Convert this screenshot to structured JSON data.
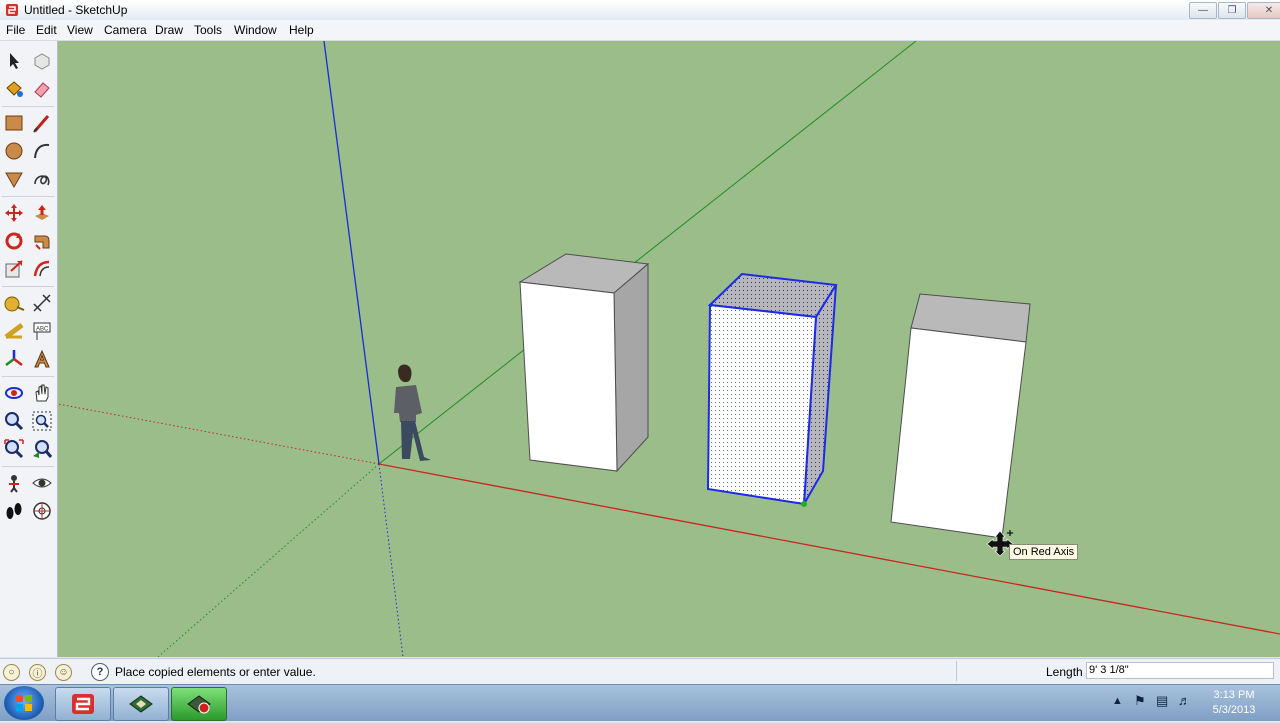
{
  "window": {
    "title": "Untitled - SketchUp"
  },
  "menu": [
    "File",
    "Edit",
    "View",
    "Camera",
    "Draw",
    "Tools",
    "Window",
    "Help"
  ],
  "toolbar": {
    "tools": [
      "select-icon",
      "make-component-icon",
      "paint-bucket-icon",
      "eraser-icon",
      "rectangle-icon",
      "line-icon",
      "circle-icon",
      "arc-icon",
      "polygon-icon",
      "freehand-icon",
      "move-icon",
      "push-pull-icon",
      "rotate-icon",
      "follow-me-icon",
      "scale-icon",
      "offset-icon",
      "tape-measure-icon",
      "dimension-icon",
      "protractor-icon",
      "text-icon",
      "axes-icon",
      "3d-text-icon",
      "orbit-icon",
      "pan-icon",
      "zoom-icon",
      "zoom-window-icon",
      "zoom-extents-icon",
      "previous-view-icon",
      "position-camera-icon",
      "look-around-icon",
      "walk-icon",
      "section-plane-icon"
    ]
  },
  "viewport": {
    "tooltip": "On Red Axis"
  },
  "status": {
    "message": "Place copied elements or enter value.",
    "length_label": "Length",
    "length_value": "9' 3 1/8\""
  },
  "taskbar": {
    "time": "3:13 PM",
    "date": "5/3/2013"
  },
  "colors": {
    "viewport_bg": "#9bbd8a",
    "red_axis": "#c8261f",
    "green_axis": "#1f8d1f",
    "blue_axis": "#1b2bd6",
    "selection": "#1c2be6"
  }
}
